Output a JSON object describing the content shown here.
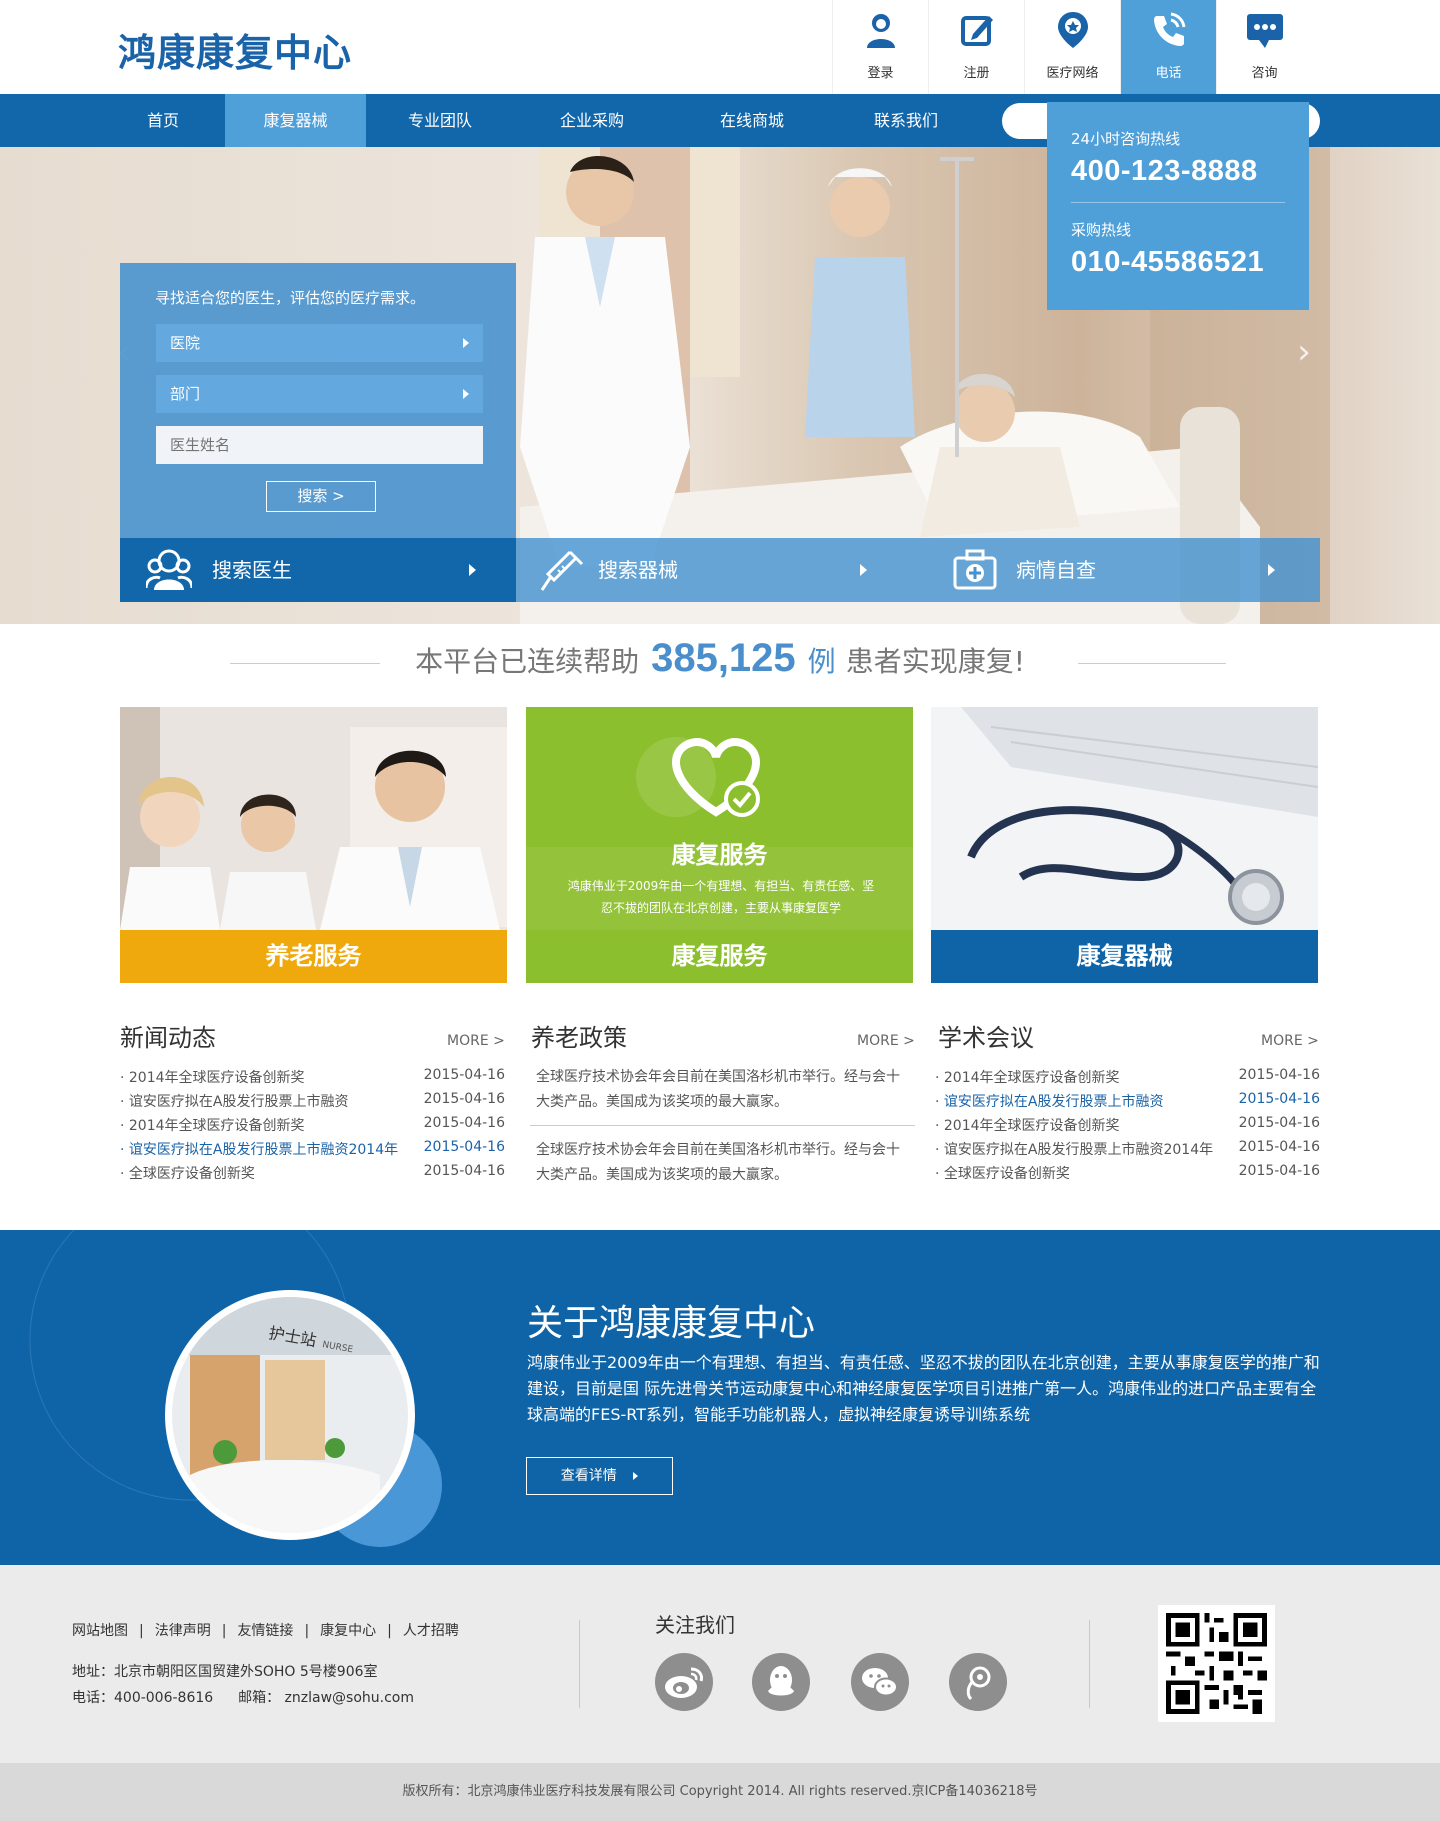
{
  "logo": "鸿康康复中心",
  "top_icons": [
    {
      "label": "登录",
      "icon": "user-icon"
    },
    {
      "label": "注册",
      "icon": "edit-icon"
    },
    {
      "label": "医疗网络",
      "icon": "location-pin-icon"
    },
    {
      "label": "电话",
      "icon": "phone-icon"
    },
    {
      "label": "咨询",
      "icon": "chat-icon"
    }
  ],
  "nav": {
    "items": [
      "首页",
      "康复器械",
      "专业团队",
      "企业采购",
      "在线商城",
      "联系我们"
    ],
    "active": "康复器械",
    "search_placeholder": ""
  },
  "hotline": {
    "label1": "24小时咨询热线",
    "number1": "400-123-8888",
    "label2": "采购热线",
    "number2": "010-45586521"
  },
  "hero": {
    "search_hint": "寻找适合您的医生，评估您的医疗需求。",
    "field_hospital": "医院",
    "field_department": "部门",
    "field_doctor_placeholder": "医生姓名",
    "search_button": "搜索 >",
    "bar": [
      {
        "label": "搜索医生",
        "icon": "doctors-icon"
      },
      {
        "label": "搜索器械",
        "icon": "syringe-icon"
      },
      {
        "label": "病情自查",
        "icon": "medical-kit-icon"
      }
    ]
  },
  "stats": {
    "prefix": "本平台已连续帮助",
    "number": "385,125",
    "unit": "例",
    "suffix": "患者实现康复!"
  },
  "cards": [
    {
      "label": "养老服务",
      "color": "#f0a90c"
    },
    {
      "label": "康复服务",
      "color": "#8cbf2e",
      "overlay_title": "康复服务",
      "overlay_text": "鸿康伟业于2009年由一个有理想、有担当、有责任感、坚忍不拔的团队在北京创建，主要从事康复医学"
    },
    {
      "label": "康复器械",
      "color": "#0f64a8"
    }
  ],
  "news": {
    "title": "新闻动态",
    "more": "MORE >",
    "items": [
      {
        "title": "· 2014年全球医疗设备创新奖",
        "date": "2015-04-16"
      },
      {
        "title": "· 谊安医疗拟在A股发行股票上市融资",
        "date": "2015-04-16"
      },
      {
        "title": "· 2014年全球医疗设备创新奖",
        "date": "2015-04-16"
      },
      {
        "title": "· 谊安医疗拟在A股发行股票上市融资2014年",
        "date": "2015-04-16"
      },
      {
        "title": "· 全球医疗设备创新奖",
        "date": "2015-04-16"
      }
    ]
  },
  "policy": {
    "title": "养老政策",
    "more": "MORE >",
    "items": [
      "全球医疗技术协会年会目前在美国洛杉机市举行。经与会十大类产品。美国成为该奖项的最大赢家。",
      "全球医疗技术协会年会目前在美国洛杉机市举行。经与会十大类产品。美国成为该奖项的最大赢家。"
    ]
  },
  "conference": {
    "title": "学术会议",
    "more": "MORE >",
    "items": [
      {
        "title": "· 2014年全球医疗设备创新奖",
        "date": "2015-04-16"
      },
      {
        "title": "· 谊安医疗拟在A股发行股票上市融资",
        "date": "2015-04-16"
      },
      {
        "title": "· 2014年全球医疗设备创新奖",
        "date": "2015-04-16"
      },
      {
        "title": "· 谊安医疗拟在A股发行股票上市融资2014年",
        "date": "2015-04-16"
      },
      {
        "title": "· 全球医疗设备创新奖",
        "date": "2015-04-16"
      }
    ]
  },
  "about": {
    "title": "关于鸿康康复中心",
    "text": "鸿康伟业于2009年由一个有理想、有担当、有责任感、坚忍不拔的团队在北京创建，主要从事康复医学的推广和建设，目前是国 际先进骨关节运动康复中心和神经康复医学项目引进推广第一人。鸿康伟业的进口产品主要有全球高端的FES-RT系列，智能手功能机器人，虚拟神经康复诱导训练系统",
    "button": "查看详情",
    "sign_text": "护士站",
    "sign_text_en": "NURSE"
  },
  "footer": {
    "links": [
      "网站地图",
      "法律声明",
      "友情链接",
      "康复中心",
      "人才招聘"
    ],
    "address": "地址：北京市朝阳区国贸建外SOHO 5号楼906室",
    "phone": "电话：400-006-8616",
    "email": "邮箱： znzlaw@sohu.com",
    "follow": "关注我们",
    "social": [
      "weibo-icon",
      "qq-icon",
      "wechat-icon",
      "tencent-weibo-icon"
    ],
    "copyright": "版权所有：北京鸿康伟业医疗科技发展有限公司    Copyright 2014. All rights reserved.京ICP备14036218号"
  }
}
